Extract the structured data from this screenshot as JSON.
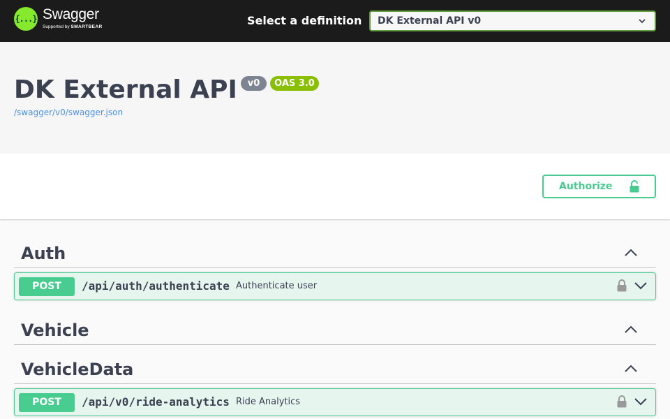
{
  "topbar": {
    "logo_glyph": "{...}",
    "logo_title": "Swagger",
    "logo_sub_prefix": "Supported by",
    "logo_sub_brand": "SMARTBEAR",
    "definition_label": "Select a definition",
    "definition_selected": "DK External API v0"
  },
  "info": {
    "title": "DK External API",
    "version_badge": "v0",
    "oas_badge": "OAS 3.0",
    "spec_url": "/swagger/v0/swagger.json"
  },
  "scheme": {
    "authorize_label": "Authorize"
  },
  "tags": [
    {
      "name": "Auth",
      "operations": [
        {
          "method": "POST",
          "path": "/api/auth/authenticate",
          "summary": "Authenticate user"
        }
      ]
    },
    {
      "name": "Vehicle",
      "operations": []
    },
    {
      "name": "VehicleData",
      "operations": [
        {
          "method": "POST",
          "path": "/api/v0/ride-analytics",
          "summary": "Ride Analytics"
        }
      ]
    }
  ],
  "colors": {
    "topbar_bg": "#1b1b1b",
    "accent_green": "#49cc90",
    "logo_green": "#85ea2d",
    "version_badge": "#7d8492",
    "oas_badge": "#89bf04",
    "link": "#4990e2"
  },
  "icons": {
    "select_caret": "chevron-down-icon",
    "authorize": "lock-icon",
    "tag_toggle": "chevron-up-icon",
    "op_lock": "lock-icon",
    "op_toggle": "chevron-down-icon"
  }
}
